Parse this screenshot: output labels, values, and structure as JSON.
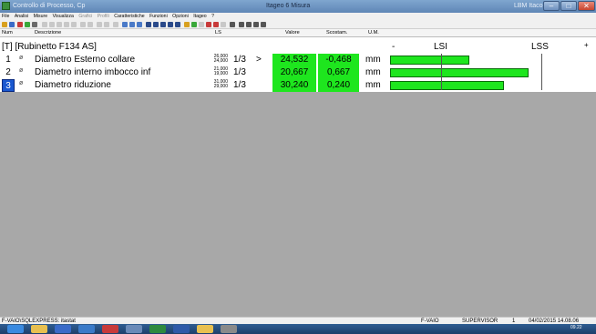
{
  "window": {
    "app_title": "Controllo di Processo, Cp",
    "title": "Itageo 6 Misura",
    "user": "LBM Itaco",
    "min_label": "–",
    "max_label": "□",
    "close_label": "✕"
  },
  "menu": [
    "File",
    "Analisi",
    "Misure",
    "Visualizza",
    "Grafici",
    "Profili",
    "Caratteristiche",
    "Funzioni",
    "Opzioni",
    "Itageo",
    "?"
  ],
  "header": {
    "num": "Num",
    "descrizione": "Descrizione",
    "ls": "LS",
    "valore": "Valore",
    "scostam": "Scostam.",
    "um": "U.M."
  },
  "group": {
    "name": "[T] [Rubinetto F134 AS]",
    "dash": "-",
    "lsi": "LSI",
    "lss": "LSS",
    "plus": "+"
  },
  "rows": [
    {
      "num": "1",
      "icon": "ø",
      "desc": "Diametro Esterno collare",
      "ls_hi": "26,000",
      "ls_lo": "24,000",
      "frac": "1/3",
      "mark": ">",
      "value": "24,532",
      "dev": "-0,468",
      "um": "mm",
      "bar_fraction": 0.39
    },
    {
      "num": "2",
      "icon": "ø",
      "desc": "Diametro interno imbocco inf",
      "ls_hi": "21,000",
      "ls_lo": "19,000",
      "frac": "1/3",
      "mark": "",
      "value": "20,667",
      "dev": "0,667",
      "um": "mm",
      "bar_fraction": 0.68
    },
    {
      "num": "3",
      "icon": "ø",
      "desc": "Diametro riduzione",
      "ls_hi": "31,000",
      "ls_lo": "29,000",
      "frac": "1/3",
      "mark": "",
      "value": "30,240",
      "dev": "0,240",
      "um": "mm",
      "bar_fraction": 0.56
    }
  ],
  "status": {
    "db": "F-VAIO\\SQLEXPRESS: itastat",
    "machine": "F-VAIO",
    "role": "SUPERVISOR",
    "count": "1",
    "datetime": "04/02/2015 14.08.06"
  },
  "taskbar": {
    "time": "09.22"
  },
  "colors": {
    "ok_green": "#1ee61e",
    "selected_blue": "#1a58d0",
    "workspace_gray": "#a8a8a8"
  }
}
